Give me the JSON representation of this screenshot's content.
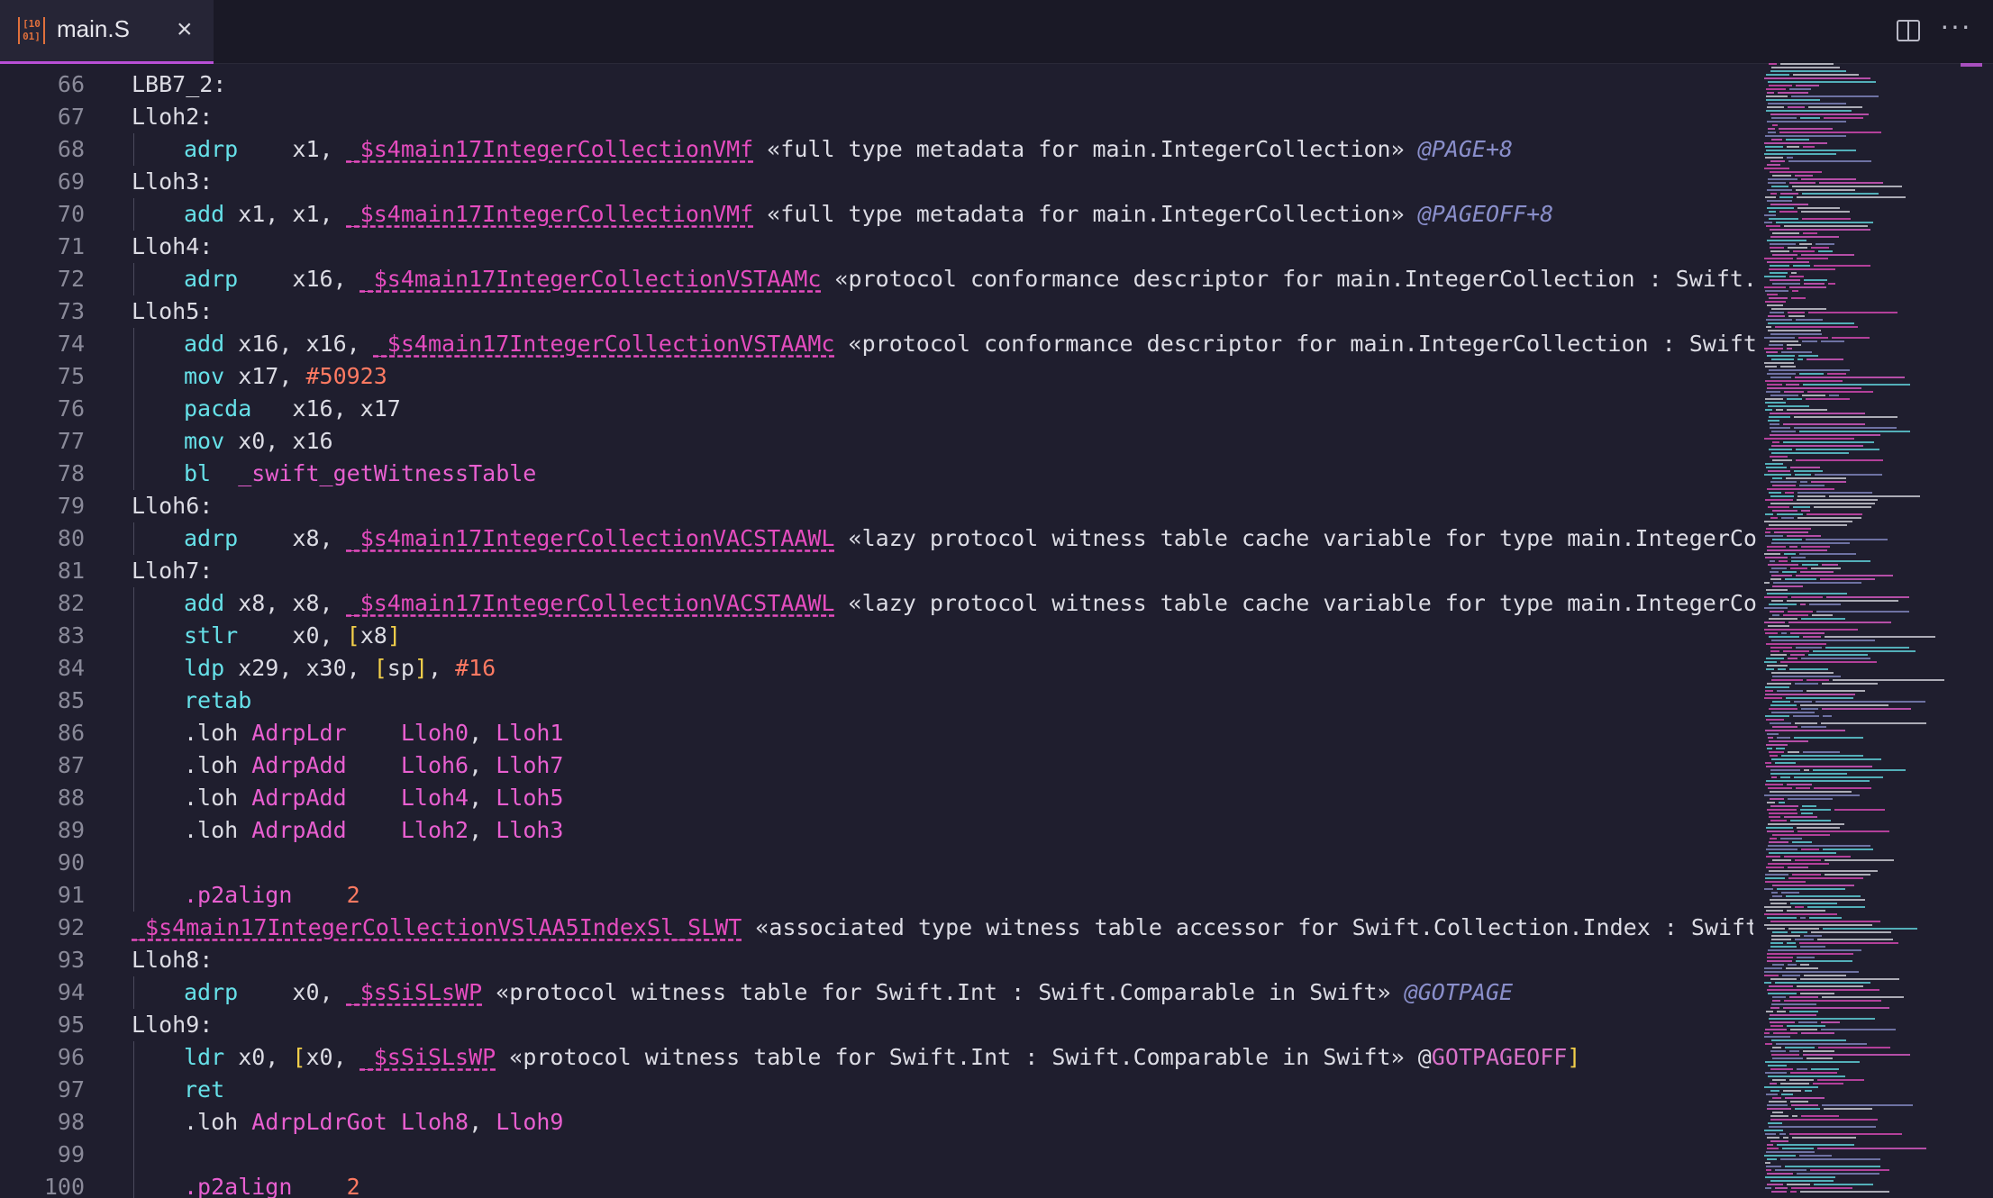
{
  "tab": {
    "icon_label": "[10 01]",
    "title": "main.S",
    "close_glyph": "×"
  },
  "toolbar": {
    "split_editor_icon": "split-editor-icon",
    "more_glyph": "···"
  },
  "lines": [
    {
      "n": "66",
      "indent": false,
      "tokens": [
        [
          "r",
          "LBB7_2:"
        ]
      ]
    },
    {
      "n": "67",
      "indent": false,
      "tokens": [
        [
          "r",
          "Lloh2:"
        ]
      ]
    },
    {
      "n": "68",
      "indent": true,
      "tokens": [
        [
          "k",
          "adrp"
        ],
        [
          "r",
          "    x1, "
        ],
        [
          "sym",
          "_$s4main17IntegerCollectionVMf"
        ],
        [
          "r",
          " «full type metadata for main.IntegerCollection» "
        ],
        [
          "rel",
          "@PAGE+8"
        ]
      ]
    },
    {
      "n": "69",
      "indent": false,
      "tokens": [
        [
          "r",
          "Lloh3:"
        ]
      ]
    },
    {
      "n": "70",
      "indent": true,
      "tokens": [
        [
          "k",
          "add"
        ],
        [
          "r",
          " x1, x1, "
        ],
        [
          "sym",
          "_$s4main17IntegerCollectionVMf"
        ],
        [
          "r",
          " «full type metadata for main.IntegerCollection» "
        ],
        [
          "rel",
          "@PAGEOFF+8"
        ]
      ]
    },
    {
      "n": "71",
      "indent": false,
      "tokens": [
        [
          "r",
          "Lloh4:"
        ]
      ]
    },
    {
      "n": "72",
      "indent": true,
      "tokens": [
        [
          "k",
          "adrp"
        ],
        [
          "r",
          "    x16, "
        ],
        [
          "sym",
          "_$s4main17IntegerCollectionVSTAAMc"
        ],
        [
          "r",
          " «protocol conformance descriptor for main.IntegerCollection : Swift.Seque"
        ]
      ]
    },
    {
      "n": "73",
      "indent": false,
      "tokens": [
        [
          "r",
          "Lloh5:"
        ]
      ]
    },
    {
      "n": "74",
      "indent": true,
      "tokens": [
        [
          "k",
          "add"
        ],
        [
          "r",
          " x16, x16, "
        ],
        [
          "sym",
          "_$s4main17IntegerCollectionVSTAAMc"
        ],
        [
          "r",
          " «protocol conformance descriptor for main.IntegerCollection : Swift.Sequ"
        ]
      ]
    },
    {
      "n": "75",
      "indent": true,
      "tokens": [
        [
          "k",
          "mov"
        ],
        [
          "r",
          " x17, "
        ],
        [
          "num",
          "#50923"
        ]
      ]
    },
    {
      "n": "76",
      "indent": true,
      "tokens": [
        [
          "k",
          "pacda"
        ],
        [
          "r",
          "   x16, x17"
        ]
      ]
    },
    {
      "n": "77",
      "indent": true,
      "tokens": [
        [
          "k",
          "mov"
        ],
        [
          "r",
          " x0, x16"
        ]
      ]
    },
    {
      "n": "78",
      "indent": true,
      "tokens": [
        [
          "k",
          "bl"
        ],
        [
          "r",
          "  "
        ],
        [
          "lbl",
          "_swift_getWitnessTable"
        ]
      ]
    },
    {
      "n": "79",
      "indent": false,
      "tokens": [
        [
          "r",
          "Lloh6:"
        ]
      ]
    },
    {
      "n": "80",
      "indent": true,
      "tokens": [
        [
          "k",
          "adrp"
        ],
        [
          "r",
          "    x8, "
        ],
        [
          "sym",
          "_$s4main17IntegerCollectionVACSTAAWL"
        ],
        [
          "r",
          " «lazy protocol witness table cache variable for type main.IntegerCollect"
        ]
      ]
    },
    {
      "n": "81",
      "indent": false,
      "tokens": [
        [
          "r",
          "Lloh7:"
        ]
      ]
    },
    {
      "n": "82",
      "indent": true,
      "tokens": [
        [
          "k",
          "add"
        ],
        [
          "r",
          " x8, x8, "
        ],
        [
          "sym",
          "_$s4main17IntegerCollectionVACSTAAWL"
        ],
        [
          "r",
          " «lazy protocol witness table cache variable for type main.IntegerCollect"
        ]
      ]
    },
    {
      "n": "83",
      "indent": true,
      "tokens": [
        [
          "k",
          "stlr"
        ],
        [
          "r",
          "    x0, "
        ],
        [
          "br",
          "["
        ],
        [
          "r",
          "x8"
        ],
        [
          "br",
          "]"
        ]
      ]
    },
    {
      "n": "84",
      "indent": true,
      "tokens": [
        [
          "k",
          "ldp"
        ],
        [
          "r",
          " x29, x30, "
        ],
        [
          "br",
          "["
        ],
        [
          "r",
          "sp"
        ],
        [
          "br",
          "]"
        ],
        [
          "r",
          ", "
        ],
        [
          "num",
          "#16"
        ]
      ]
    },
    {
      "n": "85",
      "indent": true,
      "tokens": [
        [
          "k",
          "retab"
        ]
      ]
    },
    {
      "n": "86",
      "indent": true,
      "tokens": [
        [
          "dir",
          ".loh "
        ],
        [
          "lbl",
          "AdrpLdr"
        ],
        [
          "r",
          "    "
        ],
        [
          "lbl",
          "Lloh0"
        ],
        [
          "r",
          ", "
        ],
        [
          "lbl",
          "Lloh1"
        ]
      ]
    },
    {
      "n": "87",
      "indent": true,
      "tokens": [
        [
          "dir",
          ".loh "
        ],
        [
          "lbl",
          "AdrpAdd"
        ],
        [
          "r",
          "    "
        ],
        [
          "lbl",
          "Lloh6"
        ],
        [
          "r",
          ", "
        ],
        [
          "lbl",
          "Lloh7"
        ]
      ]
    },
    {
      "n": "88",
      "indent": true,
      "tokens": [
        [
          "dir",
          ".loh "
        ],
        [
          "lbl",
          "AdrpAdd"
        ],
        [
          "r",
          "    "
        ],
        [
          "lbl",
          "Lloh4"
        ],
        [
          "r",
          ", "
        ],
        [
          "lbl",
          "Lloh5"
        ]
      ]
    },
    {
      "n": "89",
      "indent": true,
      "tokens": [
        [
          "dir",
          ".loh "
        ],
        [
          "lbl",
          "AdrpAdd"
        ],
        [
          "r",
          "    "
        ],
        [
          "lbl",
          "Lloh2"
        ],
        [
          "r",
          ", "
        ],
        [
          "lbl",
          "Lloh3"
        ]
      ]
    },
    {
      "n": "90",
      "indent": true,
      "tokens": []
    },
    {
      "n": "91",
      "indent": true,
      "tokens": [
        [
          "lbl",
          ".p2align"
        ],
        [
          "r",
          "    "
        ],
        [
          "num",
          "2"
        ]
      ]
    },
    {
      "n": "92",
      "indent": false,
      "tokens": [
        [
          "sym",
          "_$s4main17IntegerCollectionVSlAA5IndexSl_SLWT"
        ],
        [
          "r",
          " «associated type witness table accessor for Swift.Collection.Index : Swift.Comp"
        ]
      ]
    },
    {
      "n": "93",
      "indent": false,
      "tokens": [
        [
          "r",
          "Lloh8:"
        ]
      ]
    },
    {
      "n": "94",
      "indent": true,
      "tokens": [
        [
          "k",
          "adrp"
        ],
        [
          "r",
          "    x0, "
        ],
        [
          "sym",
          "_$sSiSLsWP"
        ],
        [
          "r",
          " «protocol witness table for Swift.Int : Swift.Comparable in Swift» "
        ],
        [
          "rel",
          "@GOTPAGE"
        ]
      ]
    },
    {
      "n": "95",
      "indent": false,
      "tokens": [
        [
          "r",
          "Lloh9:"
        ]
      ]
    },
    {
      "n": "96",
      "indent": true,
      "tokens": [
        [
          "k",
          "ldr"
        ],
        [
          "r",
          " x0, "
        ],
        [
          "br",
          "["
        ],
        [
          "r",
          "x0, "
        ],
        [
          "sym",
          "_$sSiSLsWP"
        ],
        [
          "r",
          " «protocol witness table for Swift.Int : Swift.Comparable in Swift» "
        ],
        [
          "relp",
          "@"
        ],
        [
          "rel2",
          "GOTPAGEOFF"
        ],
        [
          "br",
          "]"
        ]
      ]
    },
    {
      "n": "97",
      "indent": true,
      "tokens": [
        [
          "k",
          "ret"
        ]
      ]
    },
    {
      "n": "98",
      "indent": true,
      "tokens": [
        [
          "dir",
          ".loh "
        ],
        [
          "lbl",
          "AdrpLdrGot"
        ],
        [
          "r",
          " "
        ],
        [
          "lbl",
          "Lloh8"
        ],
        [
          "r",
          ", "
        ],
        [
          "lbl",
          "Lloh9"
        ]
      ]
    },
    {
      "n": "99",
      "indent": true,
      "tokens": []
    },
    {
      "n": "100",
      "indent": true,
      "tokens": [
        [
          "lbl",
          ".p2align"
        ],
        [
          "r",
          "    "
        ],
        [
          "num",
          "2"
        ]
      ]
    }
  ],
  "colors": {
    "background": "#1f1e2e",
    "keyword": "#66e0e8",
    "symbol": "#e54cbf",
    "number": "#ff7a62",
    "bracket": "#f2cf4a",
    "relocation": "#8a8fcb",
    "line_number": "#8a8a99",
    "tab_accent": "#b84fd6"
  }
}
